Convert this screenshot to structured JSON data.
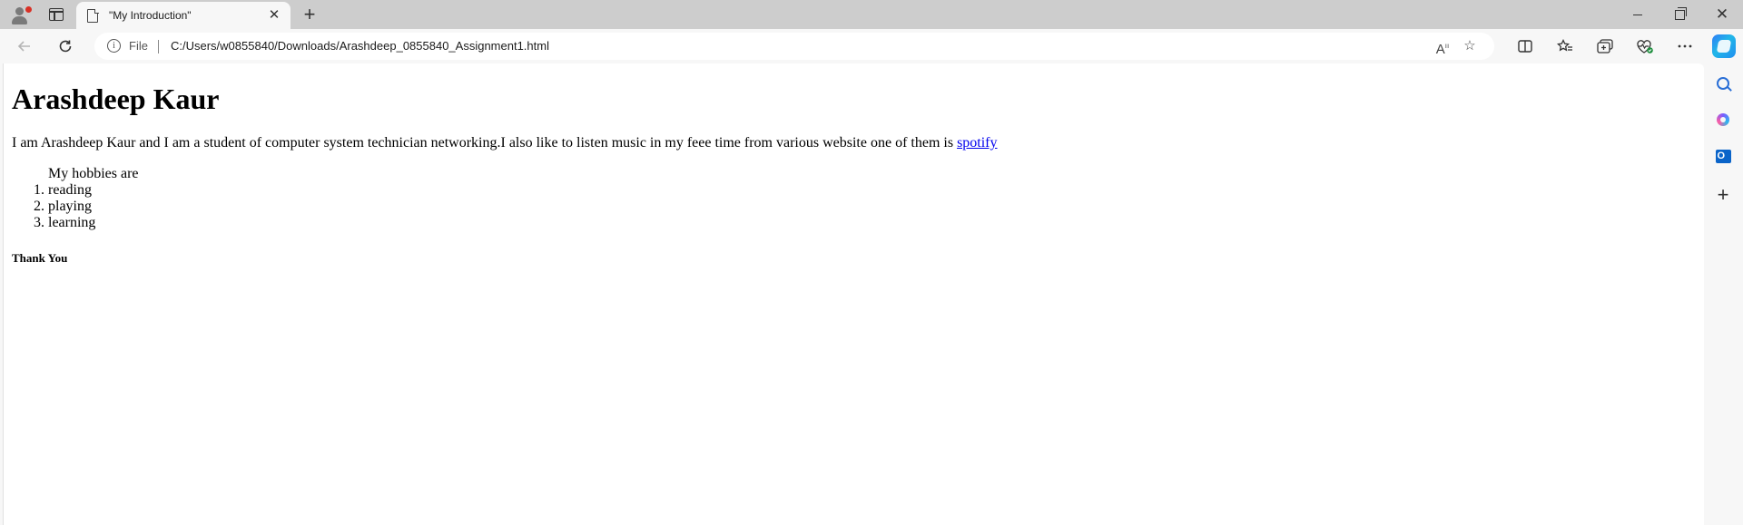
{
  "browser": {
    "tab_title": "\"My Introduction\"",
    "tab_close": "✕",
    "new_tab": "+",
    "address": {
      "scheme_label": "File",
      "url": "C:/Users/w0855840/Downloads/Arashdeep_0855840_Assignment1.html"
    },
    "window_controls": {
      "close": "✕"
    }
  },
  "page": {
    "heading": "Arashdeep Kaur",
    "intro_text": "I am Arashdeep Kaur and I am a student of computer system technician networking.I also like to listen music in my feee time from various website one of them is ",
    "link_text": "spotify",
    "hobbies_label": "My hobbies are",
    "hobbies": [
      "reading",
      "playing",
      "learning"
    ],
    "closing": "Thank You"
  },
  "icons": {
    "back": "arrow-left-icon",
    "refresh": "refresh-icon",
    "info": "info-icon",
    "read_aloud": "read-aloud-icon",
    "favorite": "star-icon",
    "split_screen": "split-screen-icon",
    "favorites": "favorites-icon",
    "collections": "collections-icon",
    "browser_essentials": "heart-pulse-icon",
    "more": "more-icon",
    "copilot": "copilot-icon"
  }
}
